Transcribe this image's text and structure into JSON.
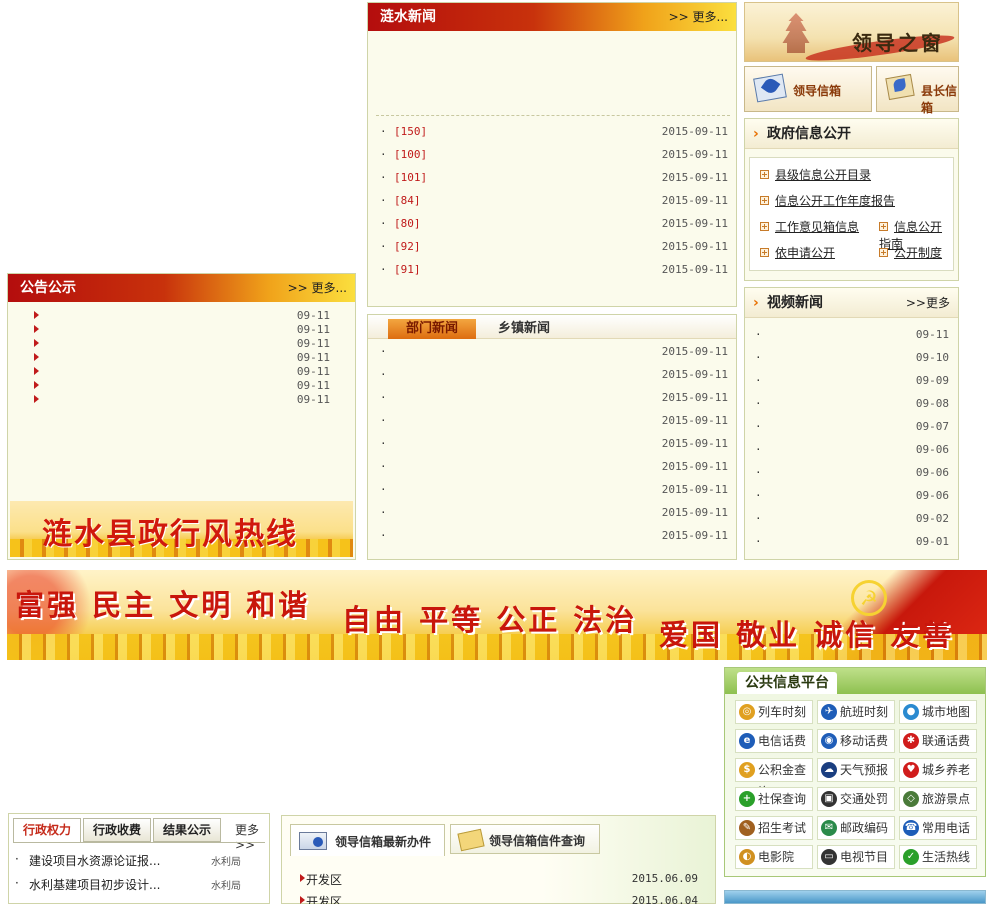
{
  "notice": {
    "title": "公告公示",
    "more": ">> 更多...",
    "dates": [
      "09-11",
      "09-11",
      "09-11",
      "09-11",
      "09-11",
      "09-11",
      "09-11"
    ]
  },
  "hotline_banner": "涟水县政行风热线",
  "news": {
    "title": "涟水新闻",
    "more": ">> 更多...",
    "items": [
      {
        "num": "[150]",
        "date": "2015-09-11"
      },
      {
        "num": "[100]",
        "date": "2015-09-11"
      },
      {
        "num": "[101]",
        "date": "2015-09-11"
      },
      {
        "num": "[84]",
        "date": "2015-09-11"
      },
      {
        "num": "[80]",
        "date": "2015-09-11"
      },
      {
        "num": "[92]",
        "date": "2015-09-11"
      },
      {
        "num": "[91]",
        "date": "2015-09-11"
      }
    ]
  },
  "dept_news": {
    "tab_active": "部门新闻",
    "tab_other": "乡镇新闻",
    "dates": [
      "2015-09-11",
      "2015-09-11",
      "2015-09-11",
      "2015-09-11",
      "2015-09-11",
      "2015-09-11",
      "2015-09-11",
      "2015-09-11",
      "2015-09-11"
    ]
  },
  "leader": {
    "banner": "领导之窗",
    "mailbox": "领导信箱",
    "county_mailbox": "县长信箱"
  },
  "gov_info": {
    "title": "政府信息公开",
    "links": [
      "县级信息公开目录",
      "信息公开工作年度报告",
      "工作意见箱信息",
      "信息公开指南",
      "依申请公开",
      "公开制度"
    ]
  },
  "video": {
    "title": "视频新闻",
    "more": ">>更多",
    "dates": [
      "09-11",
      "09-10",
      "09-09",
      "09-08",
      "09-07",
      "09-06",
      "09-06",
      "09-06",
      "09-02",
      "09-01"
    ]
  },
  "values_banner": {
    "left": "富强 民主 文明 和谐",
    "mid": "自由 平等 公正 法治",
    "right": "爱国 敬业 诚信 友善"
  },
  "public_platform": {
    "title": "公共信息平台",
    "services": [
      {
        "label": "列车时刻",
        "icon": "train-icon",
        "color": "#e0a020"
      },
      {
        "label": "航班时刻",
        "icon": "flight-icon",
        "color": "#1e5db8"
      },
      {
        "label": "城市地图",
        "icon": "globe-icon",
        "color": "#2a8ad0"
      },
      {
        "label": "电信话费",
        "icon": "telecom-icon",
        "color": "#1e5db8"
      },
      {
        "label": "移动话费",
        "icon": "mobile-icon",
        "color": "#1e5db8"
      },
      {
        "label": "联通话费",
        "icon": "unicom-icon",
        "color": "#d01c1c"
      },
      {
        "label": "公积金查询",
        "icon": "fund-icon",
        "color": "#e0a020"
      },
      {
        "label": "天气预报",
        "icon": "weather-icon",
        "color": "#1a3e80"
      },
      {
        "label": "城乡养老",
        "icon": "pension-icon",
        "color": "#d01c1c"
      },
      {
        "label": "社保查询",
        "icon": "social-security-icon",
        "color": "#2aa02a"
      },
      {
        "label": "交通处罚",
        "icon": "traffic-icon",
        "color": "#333333"
      },
      {
        "label": "旅游景点",
        "icon": "travel-icon",
        "color": "#4a7a3a"
      },
      {
        "label": "招生考试",
        "icon": "exam-icon",
        "color": "#a06020"
      },
      {
        "label": "邮政编码",
        "icon": "post-icon",
        "color": "#2a8a4a"
      },
      {
        "label": "常用电话",
        "icon": "phone-icon",
        "color": "#1e5db8"
      },
      {
        "label": "电影院",
        "icon": "cinema-icon",
        "color": "#d09020"
      },
      {
        "label": "电视节目",
        "icon": "tv-icon",
        "color": "#333333"
      },
      {
        "label": "生活热线",
        "icon": "hotline-icon",
        "color": "#2aa02a"
      }
    ]
  },
  "admin_tabs": {
    "tabs": [
      "行政权力",
      "行政收费",
      "结果公示"
    ],
    "more": "更多>>",
    "items": [
      {
        "text": "建设项目水资源论证报...",
        "dept": "水利局"
      },
      {
        "text": "水利基建项目初步设计...",
        "dept": "水利局"
      }
    ]
  },
  "mailbox_panel": {
    "tab1": "领导信箱最新办件",
    "tab2": "领导信箱信件查询",
    "items": [
      {
        "text": "开发区",
        "date": "2015.06.09"
      },
      {
        "text": "开发区",
        "date": "2015.06.04"
      }
    ]
  }
}
